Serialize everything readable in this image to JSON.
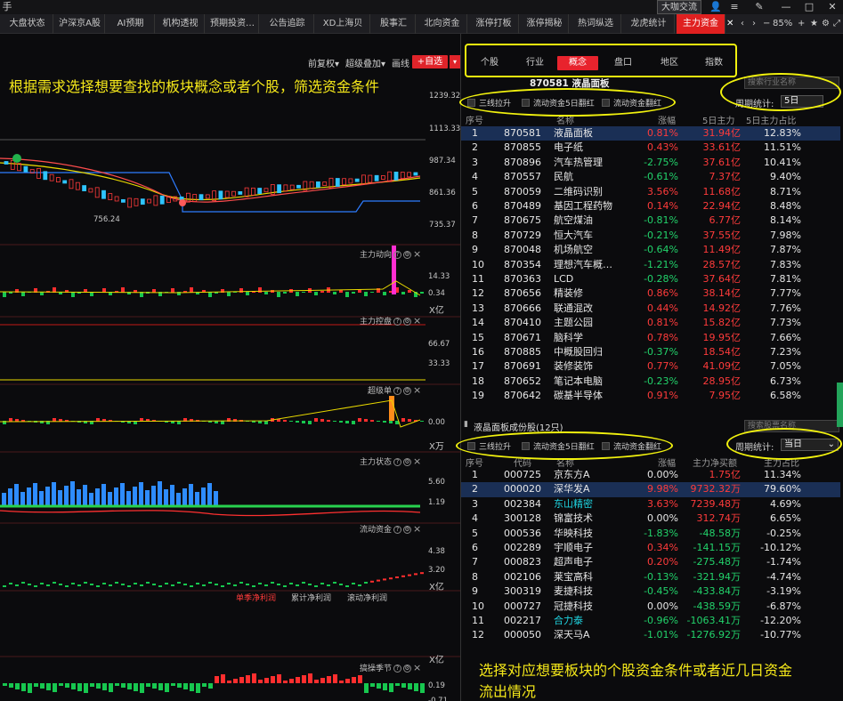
{
  "titlebar": {
    "left_char": "手",
    "app_button": "大咖交流"
  },
  "tabs": [
    "大盘状态",
    "沪深京A股",
    "AI预期",
    "机构透视",
    "预期投资…",
    "公告追踪",
    "XD上海贝",
    "股事汇",
    "北向资金",
    "涨停打板",
    "涨停揭秘",
    "热词纵选",
    "龙虎统计",
    "主力资金"
  ],
  "zoom": "85%",
  "left_toolbar": {
    "fq": "前复权",
    "stack": "超级叠加",
    "draw": "画线",
    "add": "+自选"
  },
  "annotations": {
    "left": "根据需求选择想要查找的板块概念或者个股，筛选资金条件",
    "bottom_line1": "选择对应想要板块的个股资金条件或者近几日资金",
    "bottom_line2": "流出情况"
  },
  "kline_axis": [
    "1239.32",
    "1113.33",
    "987.34",
    "861.36",
    "735.37"
  ],
  "kline_low_label": "756.24",
  "panels": [
    {
      "name": "主力动向",
      "ticks": [
        "14.33",
        "0.34",
        "X亿"
      ]
    },
    {
      "name": "主力控盘",
      "ticks": [
        "66.67",
        "33.33"
      ]
    },
    {
      "name": "超级单",
      "ticks": [
        "0.00",
        "X万"
      ]
    },
    {
      "name": "主力状态",
      "ticks": [
        "5.60",
        "1.19"
      ]
    },
    {
      "name": "流动资金",
      "ticks": [
        "4.38",
        "3.20",
        "X亿"
      ]
    },
    {
      "name": "",
      "ticks": [
        "X亿"
      ]
    },
    {
      "name": "搞操季节",
      "ticks": [
        "0.19",
        "-0.71"
      ]
    }
  ],
  "profit_tabs": [
    "单季净利润",
    "累计净利润",
    "滚动净利润"
  ],
  "right": {
    "tabs": [
      "个股",
      "行业",
      "概念",
      "盘口",
      "地区",
      "指数"
    ],
    "active_tab": "概念",
    "title": "870581  液晶面板",
    "search_placeholder": "搜索行业名称",
    "filters": [
      "三线拉升",
      "流动资金5日翻红",
      "流动资金翻红"
    ],
    "period_label": "周期统计:",
    "period_value_top": "5日",
    "columns_top": [
      "序号",
      "名称",
      "涨幅",
      "5日主力",
      "5日主力占比"
    ],
    "rows_top": [
      [
        "1",
        "870581",
        "液晶面板",
        "0.81%",
        "31.94亿",
        "12.83%"
      ],
      [
        "2",
        "870855",
        "电子纸",
        "0.43%",
        "33.61亿",
        "11.51%"
      ],
      [
        "3",
        "870896",
        "汽车热管理",
        "-2.75%",
        "37.61亿",
        "10.41%"
      ],
      [
        "4",
        "870557",
        "民航",
        "-0.61%",
        "7.37亿",
        "9.40%"
      ],
      [
        "5",
        "870059",
        "二维码识别",
        "3.56%",
        "11.68亿",
        "8.71%"
      ],
      [
        "6",
        "870489",
        "基因工程药物",
        "0.14%",
        "22.94亿",
        "8.48%"
      ],
      [
        "7",
        "870675",
        "航空煤油",
        "-0.81%",
        "6.77亿",
        "8.14%"
      ],
      [
        "8",
        "870729",
        "恒大汽车",
        "-0.21%",
        "37.55亿",
        "7.98%"
      ],
      [
        "9",
        "870048",
        "机场航空",
        "-0.64%",
        "11.49亿",
        "7.87%"
      ],
      [
        "10",
        "870354",
        "理想汽车概…",
        "-1.21%",
        "28.57亿",
        "7.83%"
      ],
      [
        "11",
        "870363",
        "LCD",
        "-0.28%",
        "37.64亿",
        "7.81%"
      ],
      [
        "12",
        "870656",
        "精装修",
        "0.86%",
        "38.14亿",
        "7.77%"
      ],
      [
        "13",
        "870666",
        "联通混改",
        "0.44%",
        "14.92亿",
        "7.76%"
      ],
      [
        "14",
        "870410",
        "主题公园",
        "0.81%",
        "15.82亿",
        "7.73%"
      ],
      [
        "15",
        "870671",
        "脑科学",
        "0.78%",
        "19.95亿",
        "7.66%"
      ],
      [
        "16",
        "870885",
        "中概股回归",
        "-0.37%",
        "18.54亿",
        "7.23%"
      ],
      [
        "17",
        "870691",
        "装修装饰",
        "0.77%",
        "41.09亿",
        "7.05%"
      ],
      [
        "18",
        "870652",
        "笔记本电脑",
        "-0.23%",
        "28.95亿",
        "6.73%"
      ],
      [
        "19",
        "870642",
        "碳基半导体",
        "0.91%",
        "7.95亿",
        "6.58%"
      ]
    ],
    "sub_title": "液晶面板成份股(12只)",
    "sub_search_placeholder": "搜索股票名称",
    "period_value_bottom": "当日",
    "columns_bottom": [
      "序号",
      "代码",
      "名称",
      "涨幅",
      "主力净买额",
      "主力占比"
    ],
    "rows_bottom": [
      [
        "1",
        "000725",
        "京东方A",
        "0.00%",
        "1.75亿",
        "11.34%"
      ],
      [
        "2",
        "000020",
        "深华发A",
        "9.98%",
        "9732.32万",
        "79.60%"
      ],
      [
        "3",
        "002384",
        "东山精密",
        "3.63%",
        "7239.48万",
        "4.69%"
      ],
      [
        "4",
        "300128",
        "锦富技术",
        "0.00%",
        "312.74万",
        "6.65%"
      ],
      [
        "5",
        "000536",
        "华映科技",
        "-1.83%",
        "-48.58万",
        "-0.25%"
      ],
      [
        "6",
        "002289",
        "宇顺电子",
        "0.34%",
        "-141.15万",
        "-10.12%"
      ],
      [
        "7",
        "000823",
        "超声电子",
        "0.20%",
        "-275.48万",
        "-1.74%"
      ],
      [
        "8",
        "002106",
        "莱宝高科",
        "-0.13%",
        "-321.94万",
        "-4.74%"
      ],
      [
        "9",
        "300319",
        "麦捷科技",
        "-0.45%",
        "-433.84万",
        "-3.19%"
      ],
      [
        "10",
        "000727",
        "冠捷科技",
        "0.00%",
        "-438.59万",
        "-6.87%"
      ],
      [
        "11",
        "002217",
        "合力泰",
        "-0.96%",
        "-1063.41万",
        "-12.20%"
      ],
      [
        "12",
        "000050",
        "深天马A",
        "-1.01%",
        "-1276.92万",
        "-10.77%"
      ]
    ]
  }
}
